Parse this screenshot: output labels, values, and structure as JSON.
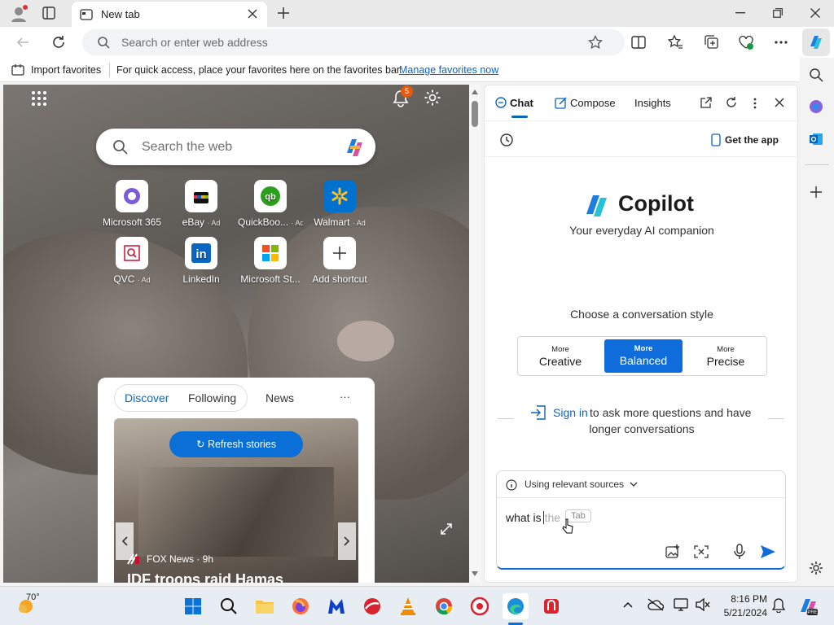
{
  "browser": {
    "tab_title": "New tab",
    "address_placeholder": "Search or enter web address"
  },
  "favorites_bar": {
    "import_label": "Import favorites",
    "hint": "For quick access, place your favorites here on the favorites bar.",
    "manage_link": "Manage favorites now"
  },
  "ntp": {
    "notification_count": "5",
    "search_placeholder": "Search the web",
    "shortcuts": [
      {
        "name": "Microsoft 365",
        "ad": ""
      },
      {
        "name": "eBay",
        "ad": "· Ad"
      },
      {
        "name": "QuickBoo...",
        "ad": "· Ad"
      },
      {
        "name": "Walmart",
        "ad": "· Ad"
      },
      {
        "name": "QVC",
        "ad": "· Ad"
      },
      {
        "name": "LinkedIn",
        "ad": ""
      },
      {
        "name": "Microsoft St...",
        "ad": ""
      },
      {
        "name": "Add shortcut",
        "ad": ""
      }
    ],
    "feed": {
      "tabs": [
        "Discover",
        "Following",
        "News"
      ],
      "more": "···",
      "refresh_label": "Refresh stories",
      "story_source": "FOX News · 9h",
      "story_title": "IDF troops raid Hamas"
    }
  },
  "copilot": {
    "tabs": [
      "Chat",
      "Compose",
      "Insights"
    ],
    "get_app": "Get the app",
    "title": "Copilot",
    "subtitle": "Your everyday AI companion",
    "style_prompt": "Choose a conversation style",
    "styles": [
      {
        "more": "More",
        "name": "Creative"
      },
      {
        "more": "More",
        "name": "Balanced"
      },
      {
        "more": "More",
        "name": "Precise"
      }
    ],
    "signin_link": "Sign in",
    "signin_text1": "to ask more questions and have",
    "signin_text2": "longer conversations",
    "sources_label": "Using relevant sources",
    "input_value": "what is",
    "input_suggestion": "the",
    "tab_hint": "Tab"
  },
  "taskbar": {
    "weather": "70°",
    "time": "8:16 PM",
    "date": "5/21/2024"
  },
  "colors": {
    "accent": "#0f6cdb",
    "link": "#0b64c0"
  }
}
